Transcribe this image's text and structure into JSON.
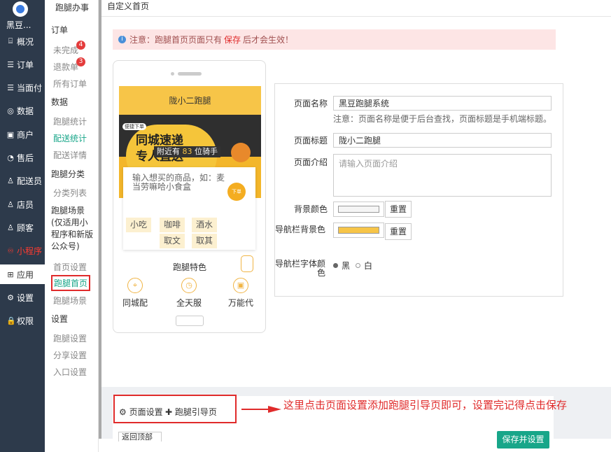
{
  "nav": {
    "brand": "黑豆...",
    "items": [
      {
        "icon": "⌸",
        "label": "概况"
      },
      {
        "icon": "☰",
        "label": "订单"
      },
      {
        "icon": "☰",
        "label": "当面付"
      },
      {
        "icon": "◎",
        "label": "数据"
      },
      {
        "icon": "▣",
        "label": "商户"
      },
      {
        "icon": "◔",
        "label": "售后"
      },
      {
        "icon": "♙",
        "label": "配送员"
      },
      {
        "icon": "♙",
        "label": "店员"
      },
      {
        "icon": "♙",
        "label": "顾客"
      },
      {
        "icon": "♾",
        "label": "小程序"
      },
      {
        "icon": "⊞",
        "label": "应用"
      },
      {
        "icon": "⚙",
        "label": "设置"
      },
      {
        "icon": "🔒",
        "label": "权限"
      }
    ]
  },
  "subnav": {
    "head": "跑腿办事",
    "groups": {
      "order": "订单",
      "data": "数据",
      "cat": "跑腿分类",
      "scene": "跑腿场景\n(仅适用小程序和新版公众号)",
      "settings": "设置"
    },
    "items": {
      "unfinished": "未完成",
      "refund": "退款单",
      "all": "所有订单",
      "stat": "跑腿统计",
      "delivery_stat": "配送统计",
      "delivery_detail": "配送详情",
      "cat_list": "分类列表",
      "home_settings": "首页设置",
      "home": "跑腿首页",
      "scene": "跑腿场景",
      "errand_settings": "跑腿设置",
      "share_settings": "分享设置",
      "entry_settings": "入口设置"
    },
    "badges": {
      "unfinished": "4",
      "refund": "3"
    }
  },
  "header": {
    "title": "自定义首页"
  },
  "notice": {
    "prefix": "注意：跑腿首页页面只有",
    "save": "保存",
    "suffix": "后才会生效！"
  },
  "phone": {
    "title": "陇小二跑腿",
    "banner": {
      "line1": "同城速递",
      "line2": "专人直送",
      "near_prefix": "附近有",
      "near_count": "83",
      "near_suffix": "位骑手",
      "tag": "便捷下单"
    },
    "search_placeholder": "输入想买的商品，如：麦当劳嘛哈小食盒",
    "go_label": "下单",
    "chips": [
      "小吃",
      "咖啡",
      "酒水",
      "取文",
      "取其"
    ],
    "features_title": "跑腿特色",
    "features": [
      "同城配",
      "全天服",
      "万能代"
    ]
  },
  "form": {
    "page_name_label": "页面名称",
    "page_name_value": "黑豆跑腿系统",
    "page_name_hint": "注意：页面名称是便于后台查找，页面标题是手机端标题。",
    "page_title_label": "页面标题",
    "page_title_value": "陇小二跑腿",
    "page_desc_label": "页面介绍",
    "page_desc_placeholder": "请输入页面介绍",
    "bg_color_label": "背景颜色",
    "navbar_bg_label": "导航栏背景色",
    "navbar_font_label": "导航栏字体颜色",
    "reset": "重置",
    "radio_black": "黑",
    "radio_white": "白",
    "colors": {
      "bg": "#f5f5f5",
      "navbar": "#f7c548"
    }
  },
  "bottom": {
    "page_settings": "页面设置",
    "guide_page": "跑腿引导页",
    "annotation": "这里点击页面设置添加跑腿引导页即可，设置完记得点击保存",
    "back_top": "返回顶部",
    "save_button": "保存并设置"
  },
  "colors": {
    "accent": "#18a689",
    "highlight": "#e02b2b",
    "brand_yellow": "#f7c548"
  }
}
